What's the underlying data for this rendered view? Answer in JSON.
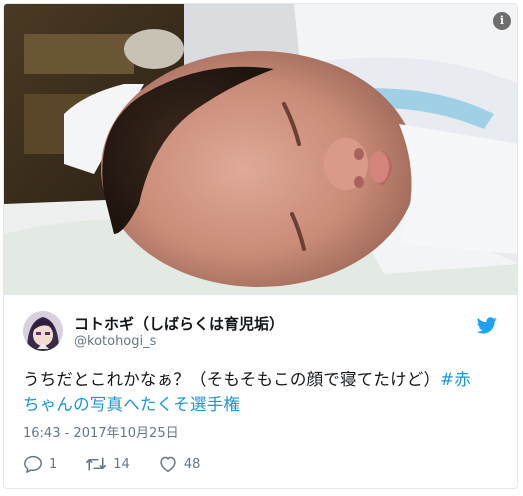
{
  "photo": {
    "info_glyph": "i",
    "alt_subject": "newborn baby photo"
  },
  "tweet": {
    "display_name": "コトホギ（しばらくは育児垢）",
    "handle": "@kotohogi_s",
    "text_plain": "うちだとこれかなぁ？（そもそもこの顔で寝てたけど）",
    "hashtag_part1": "#赤",
    "hashtag_part2": "ちゃんの写真へたくそ選手権",
    "timestamp": "16:43 - 2017年10月25日",
    "replies": "1",
    "retweets": "14",
    "likes": "48"
  },
  "colors": {
    "twitter_blue": "#1da1f2",
    "hashtag": "#1b95e0",
    "muted": "#657786",
    "text": "#14171a",
    "border": "#e1e8ed"
  },
  "icons": [
    "info-icon",
    "twitter-bird-icon",
    "reply-icon",
    "retweet-icon",
    "like-icon"
  ]
}
